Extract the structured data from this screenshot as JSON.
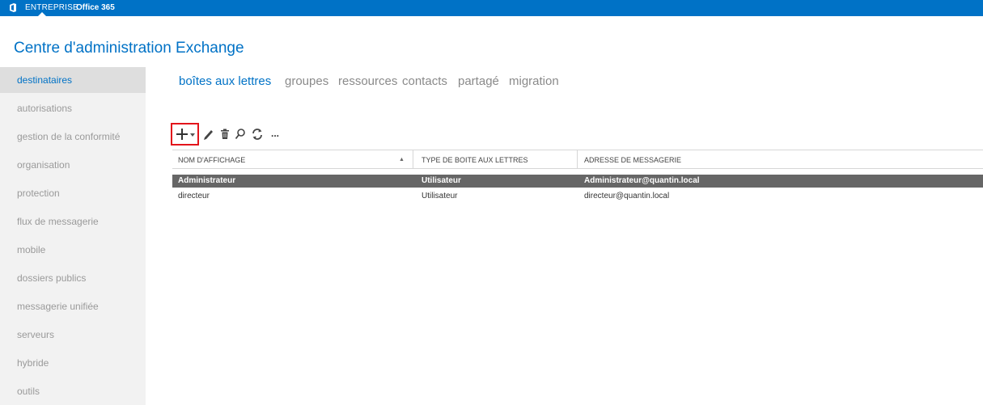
{
  "topbar": {
    "enterprise": "ENTREPRISE",
    "product": "Office 365"
  },
  "app": {
    "title": "Centre d'administration Exchange"
  },
  "sidebar": {
    "items": [
      {
        "label": "destinataires",
        "active": true
      },
      {
        "label": "autorisations"
      },
      {
        "label": "gestion de la conformité"
      },
      {
        "label": "organisation"
      },
      {
        "label": "protection"
      },
      {
        "label": "flux de messagerie"
      },
      {
        "label": "mobile"
      },
      {
        "label": "dossiers publics"
      },
      {
        "label": "messagerie unifiée"
      },
      {
        "label": "serveurs"
      },
      {
        "label": "hybride"
      },
      {
        "label": "outils"
      }
    ]
  },
  "tabs": [
    {
      "label": "boîtes aux lettres",
      "active": true
    },
    {
      "label": "groupes"
    },
    {
      "label": "ressources"
    },
    {
      "label": "contacts"
    },
    {
      "label": "partagé"
    },
    {
      "label": "migration"
    }
  ],
  "toolbar": {
    "icons": [
      "add-icon",
      "edit-icon",
      "delete-icon",
      "search-icon",
      "refresh-icon",
      "more-icon"
    ],
    "more_label": "..."
  },
  "table": {
    "columns": [
      "NOM D'AFFICHAGE",
      "TYPE DE BOITE AUX LETTRES",
      "ADRESSE DE MESSAGERIE"
    ],
    "sort_indicator": "▲",
    "rows": [
      {
        "name": "Administrateur",
        "type": "Utilisateur",
        "email": "Administrateur@quantin.local",
        "selected": true
      },
      {
        "name": "directeur",
        "type": "Utilisateur",
        "email": "directeur@quantin.local",
        "selected": false
      }
    ]
  },
  "colors": {
    "accent": "#0072c6",
    "sidebar_bg": "#f2f2f2",
    "selected_row": "#666666",
    "highlight_box": "#e3141b"
  }
}
